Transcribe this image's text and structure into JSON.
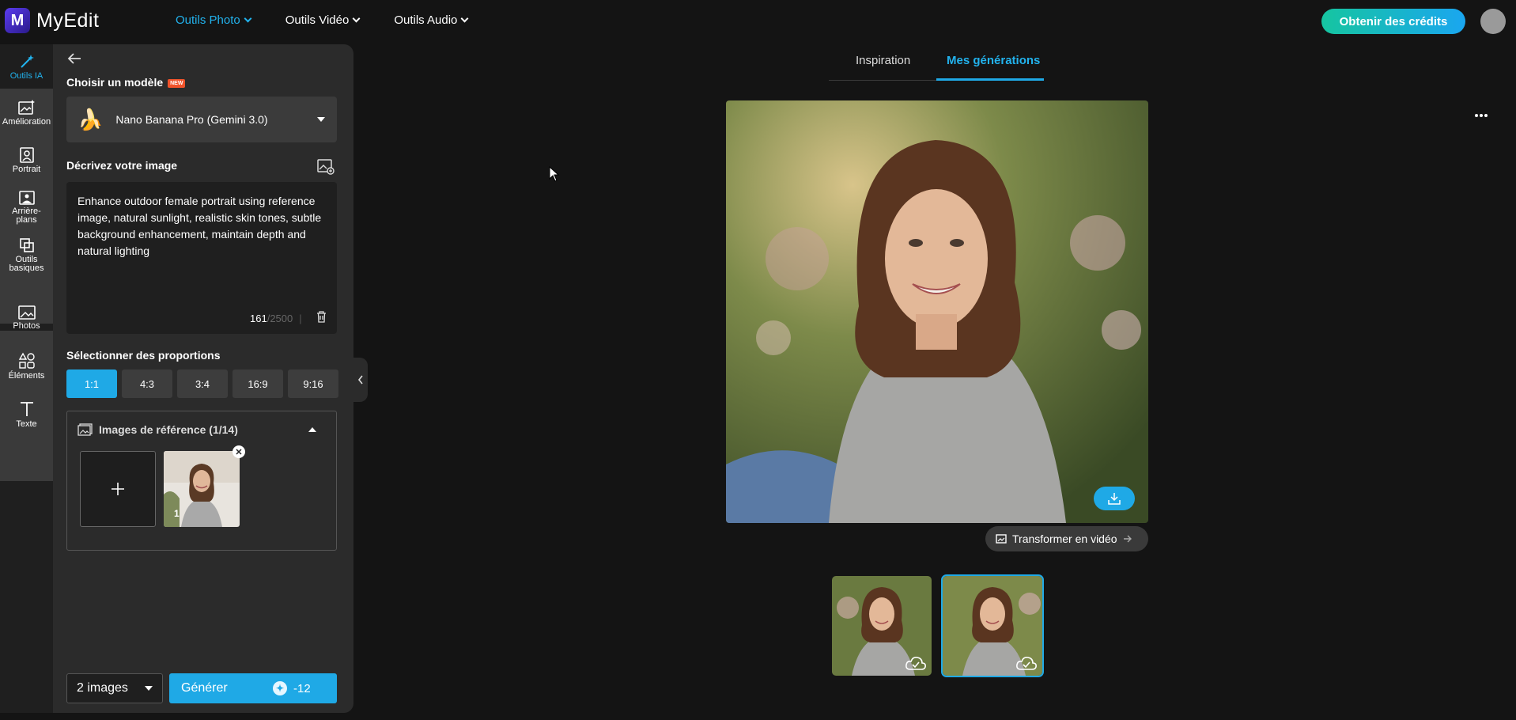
{
  "app": {
    "name": "MyEdit",
    "logo_letter": "M"
  },
  "nav": {
    "items": [
      {
        "label": "Outils Photo",
        "active": true
      },
      {
        "label": "Outils Vidéo",
        "active": false
      },
      {
        "label": "Outils Audio",
        "active": false
      }
    ]
  },
  "header": {
    "credits_button": "Obtenir des crédits"
  },
  "rail": {
    "items": [
      {
        "label": "Outils IA",
        "icon": "magic-wand-icon",
        "active": true
      },
      {
        "label": "Amélioration",
        "icon": "image-enhance-icon"
      },
      {
        "label": "Portrait",
        "icon": "portrait-icon"
      },
      {
        "label": "Arrière-plans",
        "icon": "background-icon"
      },
      {
        "label": "Outils basiques",
        "icon": "basic-tools-icon"
      },
      {
        "label": "Photos",
        "icon": "photo-icon"
      },
      {
        "label": "Éléments",
        "icon": "shapes-icon"
      },
      {
        "label": "Texte",
        "icon": "text-icon"
      }
    ],
    "plus": "+"
  },
  "panel": {
    "model_title": "Choisir un modèle",
    "new_badge": "NEW",
    "model_value": "Nano Banana Pro (Gemini 3.0)",
    "model_emoji": "🍌",
    "describe_title": "Décrivez votre image",
    "prompt": "Enhance outdoor female portrait using reference image, natural sunlight, realistic skin tones, subtle background enhancement, maintain depth and natural lighting",
    "char_count": "161",
    "char_max": "/2500",
    "char_sep": "|",
    "ratio_title": "Sélectionner des proportions",
    "ratios": [
      {
        "label": "1:1",
        "active": true
      },
      {
        "label": "4:3"
      },
      {
        "label": "3:4"
      },
      {
        "label": "16:9"
      },
      {
        "label": "9:16"
      }
    ],
    "ref_title": "Images de référence (1/14)",
    "ref_thumb_number": "1",
    "image_count": "2 images",
    "generate_label": "Générer",
    "generate_cost": "-12"
  },
  "main": {
    "tabs": [
      {
        "label": "Inspiration",
        "active": false
      },
      {
        "label": "Mes générations",
        "active": true
      }
    ],
    "video_button": "Transformer en vidéo",
    "thumbnails": [
      {
        "selected": false
      },
      {
        "selected": true
      }
    ]
  },
  "colors": {
    "accent": "#1fa9e6",
    "credits_gradient_start": "#16c5a0",
    "badge": "#f0532b"
  }
}
